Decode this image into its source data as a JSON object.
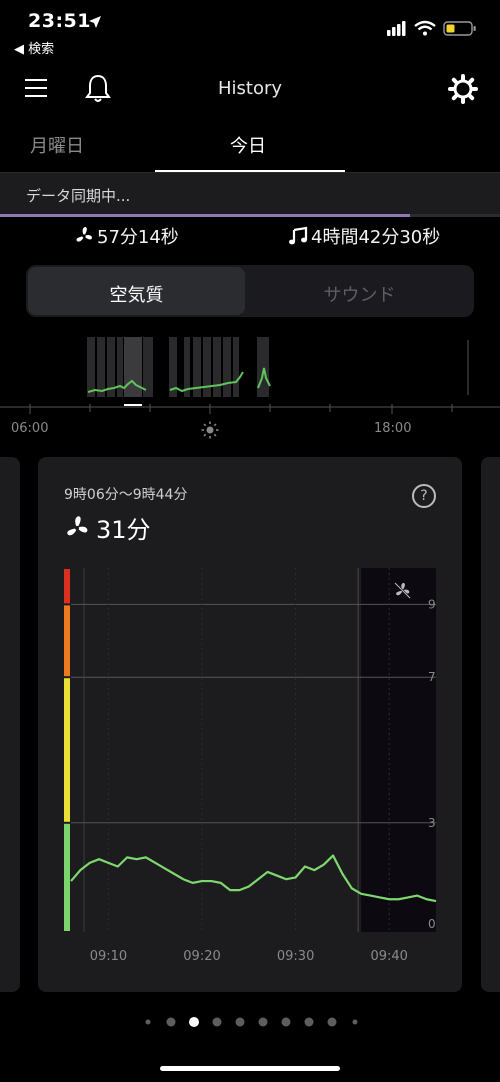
{
  "status": {
    "time": "23:51",
    "back_label": "◀ 検索"
  },
  "header": {
    "title": "History"
  },
  "tabs": [
    {
      "label": "月曜日"
    },
    {
      "label": "今日"
    }
  ],
  "sync": {
    "text": "データ同期中...",
    "progress": 0.82,
    "color": "#8e79b5"
  },
  "summary": {
    "fan_time": "57分14秒",
    "sound_time": "4時間42分30秒"
  },
  "segment": {
    "air_label": "空気質",
    "sound_label": "サウンド"
  },
  "timeline": {
    "labels": [
      "06:00",
      "18:00"
    ]
  },
  "card": {
    "range": "9時06分〜9時44分",
    "duration": "31分",
    "help": "?"
  },
  "chart_data": {
    "type": "line",
    "x": [
      "09:06",
      "09:07",
      "09:08",
      "09:09",
      "09:10",
      "09:11",
      "09:12",
      "09:13",
      "09:14",
      "09:15",
      "09:16",
      "09:17",
      "09:18",
      "09:19",
      "09:20",
      "09:21",
      "09:22",
      "09:23",
      "09:24",
      "09:25",
      "09:26",
      "09:27",
      "09:28",
      "09:29",
      "09:30",
      "09:31",
      "09:32",
      "09:33",
      "09:34",
      "09:35",
      "09:36",
      "09:37",
      "09:38",
      "09:39",
      "09:40",
      "09:41",
      "09:42",
      "09:43",
      "09:44",
      "09:45"
    ],
    "values": [
      1.4,
      1.7,
      1.9,
      2.0,
      1.9,
      1.8,
      2.05,
      2.0,
      2.05,
      1.9,
      1.75,
      1.6,
      1.45,
      1.35,
      1.4,
      1.4,
      1.35,
      1.15,
      1.15,
      1.25,
      1.45,
      1.65,
      1.55,
      1.45,
      1.5,
      1.8,
      1.7,
      1.85,
      2.1,
      1.6,
      1.2,
      1.05,
      1.0,
      0.95,
      0.9,
      0.9,
      0.95,
      1.0,
      0.9,
      0.85
    ],
    "xticks": [
      "09:10",
      "09:20",
      "09:30",
      "09:40"
    ],
    "yticks": [
      "9",
      "7",
      "3",
      "0"
    ],
    "ylim": [
      0,
      10
    ],
    "bands": [
      {
        "from": 9,
        "to": 10,
        "color": "#d8311f"
      },
      {
        "from": 7,
        "to": 9,
        "color": "#ee7a1f"
      },
      {
        "from": 3,
        "to": 7,
        "color": "#e9df35"
      },
      {
        "from": 0,
        "to": 3,
        "color": "#7bd46c"
      }
    ],
    "line_color": "#7fd86f"
  },
  "pager": {
    "count": 10,
    "active": 2
  }
}
